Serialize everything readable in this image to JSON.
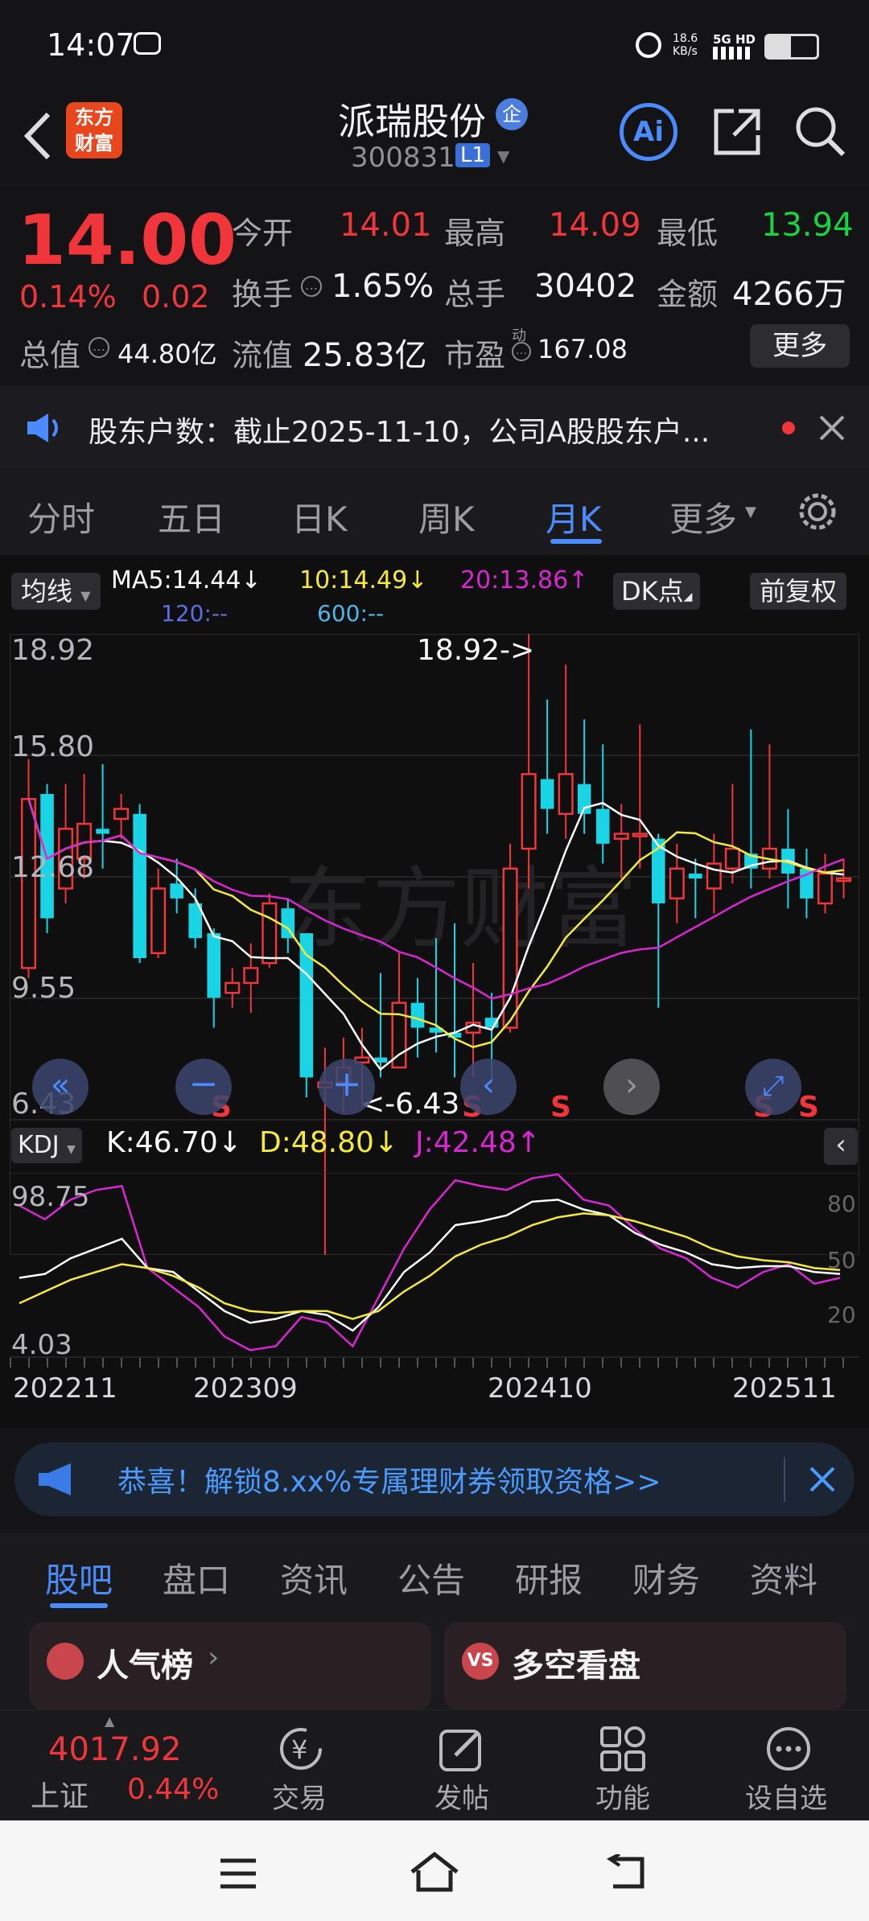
{
  "status_bar": {
    "time": "14:07",
    "speed_top": "18.6",
    "speed_bottom": "KB/s",
    "network": "5G HD"
  },
  "nav": {
    "stock_name": "派瑞股份",
    "badge": "企",
    "code": "300831",
    "level": "L1",
    "logo_line1": "东方",
    "logo_line2": "财富",
    "ai_label": "Ai"
  },
  "quote": {
    "price": "14.00",
    "change_pct": "0.14%",
    "change_amt": "0.02",
    "open_label": "今开",
    "open": "14.01",
    "high_label": "最高",
    "high": "14.09",
    "low_label": "最低",
    "low": "13.94",
    "turnover_label": "换手",
    "turnover": "1.65%",
    "volume_label": "总手",
    "volume": "30402",
    "amount_label": "金额",
    "amount": "4266万",
    "mktcap_label": "总值",
    "mktcap": "44.80亿",
    "float_label": "流值",
    "float": "25.83亿",
    "pe_label": "市盈",
    "pe_sup": "动",
    "pe": "167.08",
    "more": "更多"
  },
  "notice": {
    "text": "股东户数：截止2025-11-10，公司A股股东户..."
  },
  "chart_tabs": {
    "items": [
      "分时",
      "五日",
      "日K",
      "周K",
      "月K",
      "更多"
    ],
    "active": "月K"
  },
  "ma_bar": {
    "selector": "均线",
    "ma5": "MA5:14.44↓",
    "ma10": "10:14.49↓",
    "ma20": "20:13.86↑",
    "ma120": "120:--",
    "ma600": "600:--",
    "dk": "DK点",
    "fq": "前复权"
  },
  "kline": {
    "y_labels": [
      "18.92",
      "15.80",
      "12.68",
      "9.55",
      "6.43"
    ],
    "max_marker": "18.92->",
    "min_marker": "<-6.43",
    "watermark": "东方财富",
    "s_mark": "S"
  },
  "kdj": {
    "selector": "KDJ",
    "k": "K:46.70↓",
    "d": "D:48.80↓",
    "j": "J:42.48↑",
    "y_top": "98.75",
    "y_bottom": "4.03",
    "ref80": "80",
    "ref50": "50",
    "ref20": "20"
  },
  "x_axis": [
    "202211",
    "202309",
    "202410",
    "202511"
  ],
  "chart_data": [
    {
      "type": "candlestick",
      "ylim": [
        6.43,
        18.92
      ],
      "periods": 45,
      "max": 18.92,
      "min": 6.43,
      "ma5_last": 14.44,
      "ma10_last": 14.49,
      "ma20_last": 13.86
    },
    {
      "type": "line",
      "ylim": [
        4.03,
        98.75
      ],
      "series": [
        {
          "name": "K",
          "last": 46.7
        },
        {
          "name": "D",
          "last": 48.8
        },
        {
          "name": "J",
          "last": 42.48
        }
      ]
    }
  ],
  "banner": {
    "text": "恭喜！解锁8.xx%专属理财券领取资格>>"
  },
  "footer_tabs": {
    "items": [
      "股吧",
      "盘口",
      "资讯",
      "公告",
      "研报",
      "财务",
      "资料"
    ],
    "active": "股吧"
  },
  "cards": {
    "left": "人气榜",
    "right": "多空看盘"
  },
  "bottom": {
    "index_value": "4017.92",
    "index_name": "上证",
    "index_change": "0.44%",
    "items": [
      "交易",
      "发帖",
      "功能",
      "设自选"
    ]
  },
  "colors": {
    "up": "#f0353b",
    "down": "#18d4e4",
    "ma5": "#ffffff",
    "ma10": "#f5ea3c",
    "ma20": "#d926d0",
    "accent": "#4a8bff"
  }
}
